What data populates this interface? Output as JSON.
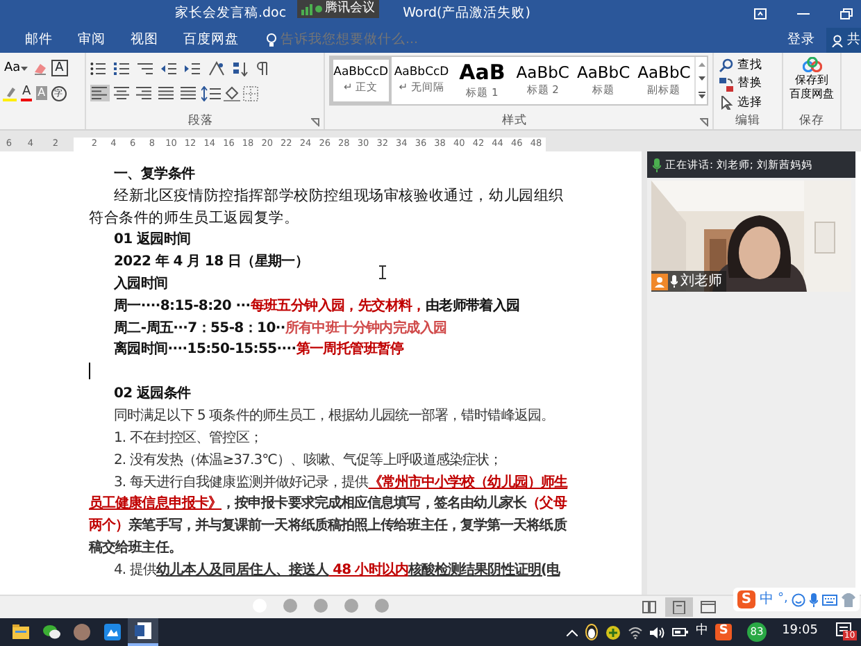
{
  "window": {
    "file_title": "家长会发言稿.doc",
    "app_title": "Word(产品激活失败)"
  },
  "meeting_badge": {
    "label": "腾讯会议"
  },
  "menu_tabs": [
    {
      "label": "邮件"
    },
    {
      "label": "审阅"
    },
    {
      "label": "视图"
    },
    {
      "label": "百度网盘"
    }
  ],
  "tell_me": {
    "placeholder": "告诉我您想要做什么..."
  },
  "account": {
    "sign_in": "登录",
    "share": "共"
  },
  "ribbon": {
    "font_tools": {
      "size_button": "Aa",
      "border_glyph": "A",
      "color_glyph": "A",
      "shading_glyph": "A",
      "enclose_glyph": "字"
    },
    "paragraph": {
      "label": "段落",
      "align": [
        {
          "kind": "left",
          "selected": true
        },
        {
          "kind": "center",
          "selected": false
        },
        {
          "kind": "right",
          "selected": false
        },
        {
          "kind": "justify",
          "selected": false
        },
        {
          "kind": "distributed",
          "selected": false
        }
      ]
    },
    "styles": {
      "label": "样式",
      "items": [
        {
          "preview": "AaBbCcD",
          "label": "↵ 正文",
          "kind": "normal",
          "selected": true
        },
        {
          "preview": "AaBbCcD",
          "label": "↵ 无间隔",
          "kind": "normal",
          "selected": false
        },
        {
          "preview": "AaB",
          "label": "标题 1",
          "kind": "heading1",
          "selected": false
        },
        {
          "preview": "AaBbC",
          "label": "标题 2",
          "kind": "heading",
          "selected": false
        },
        {
          "preview": "AaBbC",
          "label": "标题",
          "kind": "heading",
          "selected": false
        },
        {
          "preview": "AaBbC",
          "label": "副标题",
          "kind": "heading",
          "selected": false
        }
      ]
    },
    "editing": {
      "label": "编辑",
      "items": [
        {
          "label": "查找",
          "kind": "find"
        },
        {
          "label": "替换",
          "kind": "replace"
        },
        {
          "label": "选择",
          "kind": "select"
        }
      ]
    },
    "save": {
      "label": "保存",
      "button_lines": [
        "保存到",
        "百度网盘"
      ]
    }
  },
  "ruler": {
    "left_numbers": [
      "6",
      "4",
      "2"
    ],
    "numbers": [
      "2",
      "4",
      "6",
      "8",
      "10",
      "12",
      "14",
      "16",
      "18",
      "20",
      "22",
      "24",
      "26",
      "28",
      "30",
      "32",
      "34",
      "36",
      "38",
      "40",
      "42",
      "44",
      "46",
      "48"
    ]
  },
  "document": {
    "paragraphs": [
      {
        "kind": "bold",
        "runs": [
          {
            "text": "一、复学条件"
          }
        ]
      },
      {
        "kind": "body",
        "runs": [
          {
            "text": "经新北区疫情防控指挥部学校防控组现场审核验收通过，幼儿园组织符合条件的师生员工返园复学。"
          }
        ]
      },
      {
        "kind": "bold",
        "runs": [
          {
            "text": "01 返园时间"
          }
        ]
      },
      {
        "kind": "bold",
        "runs": [
          {
            "text": "2022 年 4 月 18 日（星期一）"
          }
        ]
      },
      {
        "kind": "bold",
        "runs": [
          {
            "text": "入园时间"
          }
        ]
      },
      {
        "kind": "bold",
        "runs": [
          {
            "text": "周一····8:15-8:20 ···"
          },
          {
            "text": "每班五分钟入园，先交材料，",
            "color": "#c00000"
          },
          {
            "text": "由老师带着入园"
          }
        ]
      },
      {
        "kind": "bold",
        "runs": [
          {
            "text": "周二-周五···7：55-8：10··"
          },
          {
            "text": "所有中班十分钟内完成入园",
            "color": "#d04a4a"
          }
        ]
      },
      {
        "kind": "bold",
        "runs": [
          {
            "text": "离园时间····15:50-15:55····"
          },
          {
            "text": "第一周托管班暂停",
            "color": "#c00000"
          }
        ]
      },
      {
        "kind": "empty"
      },
      {
        "kind": "bold",
        "runs": [
          {
            "text": "02 返园条件"
          }
        ]
      },
      {
        "kind": "item",
        "runs": [
          {
            "text": "同时满足以下 5 项条件的师生员工，根据幼儿园统一部署，错时错峰返园。"
          }
        ]
      },
      {
        "kind": "item",
        "runs": [
          {
            "text": "1. 不在封控区、管控区；"
          }
        ]
      },
      {
        "kind": "item",
        "runs": [
          {
            "text": "2. 没有发热（体温≥37.3℃）、咳嗽、气促等上呼吸道感染症状；"
          }
        ]
      },
      {
        "kind": "item",
        "runs": [
          {
            "text": "3. 每天进行自我健康监测并做好记录，提供"
          },
          {
            "text": "《常州市中小学校（幼儿园）师生员工健康信息申报卡》",
            "color": "#c00000",
            "bold": true,
            "underline": true
          },
          {
            "text": "，按申报卡要求完成相应信息填写，签名由幼儿家长",
            "bold": true
          },
          {
            "text": "（父母两个）",
            "color": "#c00000",
            "bold": true
          },
          {
            "text": "亲笔手写，并与复课前一天将纸质稿拍照上传给班主任，复学第一天将纸质稿交给班主任。",
            "bold": true
          }
        ]
      },
      {
        "kind": "item",
        "runs": [
          {
            "text": "4. 提供"
          },
          {
            "text": "幼儿本人及同居住人、接送人",
            "bold": true,
            "underline": true
          },
          {
            "text": " 48 小时以内",
            "color": "#c00000",
            "bold": true,
            "underline": true
          },
          {
            "text": "核酸检测结果阴性证明(电",
            "bold": true,
            "underline": true
          }
        ]
      }
    ]
  },
  "meeting": {
    "speaking": "正在讲话: 刘老师; 刘新茜妈妈",
    "participant": "刘老师",
    "mic_on": true
  },
  "status_bar": {
    "views": [
      {
        "kind": "read",
        "selected": false
      },
      {
        "kind": "print",
        "selected": true
      },
      {
        "kind": "web",
        "selected": false
      }
    ]
  },
  "ime": {
    "logo": "S",
    "lang": "中",
    "punct": "°,"
  },
  "taskbar": {
    "apps": [
      {
        "kind": "explorer",
        "active": false
      },
      {
        "kind": "wechat",
        "active": false
      },
      {
        "kind": "avatar",
        "active": false
      },
      {
        "kind": "blue",
        "active": false
      },
      {
        "kind": "word",
        "active": true
      }
    ],
    "tray": {
      "lang": "中",
      "logo": "S",
      "security": "83",
      "time": "19:05",
      "notifications": "10"
    }
  }
}
